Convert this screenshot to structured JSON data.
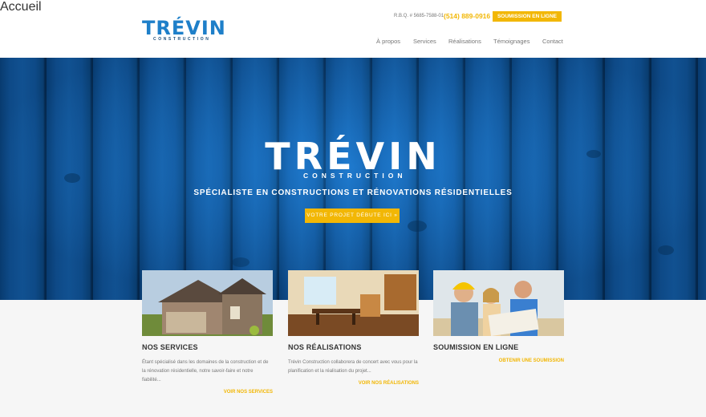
{
  "header": {
    "logo_word": "TRÉVIN",
    "logo_sub": "CONSTRUCTION",
    "rbq": "R.B.Q. # 5685-7588-01",
    "phone": "(514) 889-0916",
    "cta": "SOUMISSION EN LIGNE"
  },
  "nav": {
    "items": [
      {
        "label": "Accueil"
      },
      {
        "label": "À propos"
      },
      {
        "label": "Services"
      },
      {
        "label": "Réalisations"
      },
      {
        "label": "Témoignages"
      },
      {
        "label": "Contact"
      }
    ]
  },
  "hero": {
    "logo_word": "TRÉVIN",
    "logo_sub": "CONSTRUCTION",
    "tagline": "SPÉCIALISTE EN CONSTRUCTIONS ET RÉNOVATIONS RÉSIDENTIELLES",
    "button": "VOTRE PROJET DÉBUTE ICI »"
  },
  "cards": [
    {
      "title": "NOS SERVICES",
      "text": "Étant spécialisé dans les domaines de la construction et de la rénovation résidentielle, notre savoir-faire et notre fiabilité...",
      "link": "VOIR NOS SERVICES"
    },
    {
      "title": "NOS RÉALISATIONS",
      "text": "Trévin Construction collaborera de concert avec vous pour la planification et la réalisation du projet...",
      "link": "VOIR NOS RÉALISATIONS"
    },
    {
      "title": "SOUMISSION EN LIGNE",
      "text": "",
      "link": "OBTENIR UNE SOUMISSION"
    }
  ],
  "colors": {
    "accent": "#f2b705",
    "brand_blue": "#1e7fc9"
  }
}
